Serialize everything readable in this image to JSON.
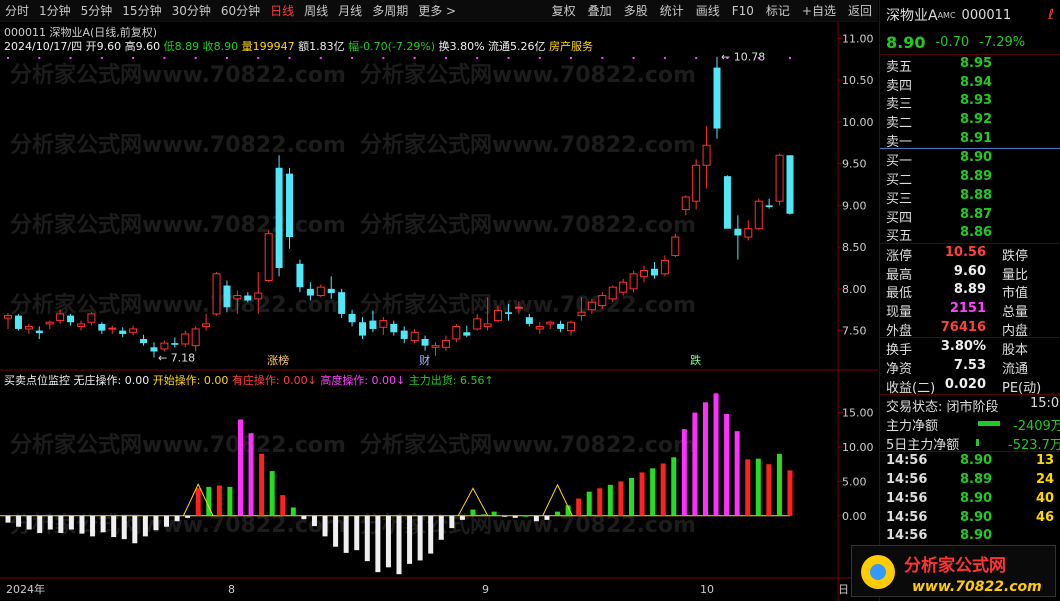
{
  "toolbar": {
    "left": [
      "分时",
      "1分钟",
      "5分钟",
      "15分钟",
      "30分钟",
      "60分钟",
      "日线",
      "周线",
      "月线",
      "多周期",
      "更多 >"
    ],
    "active_index": 6,
    "right": [
      "复权",
      "叠加",
      "多股",
      "统计",
      "画线",
      "F10",
      "标记",
      "+自选",
      "返回"
    ]
  },
  "chart_header": {
    "title": "000011 深物业A(日线,前复权)",
    "date": "2024/10/17/四",
    "open": "开9.60",
    "high": "高9.60",
    "low": "低8.89",
    "close": "收8.90",
    "volume": "量199947",
    "amount": "额1.83亿",
    "change": "幅-0.70(-7.29%)",
    "turnover": "换3.80%",
    "float": "流通5.26亿",
    "sector": "房产服务"
  },
  "price_axis": [
    "11.00",
    "10.50",
    "10.00",
    "9.50",
    "9.00",
    "8.50",
    "8.00",
    "7.50"
  ],
  "price_annotations": {
    "high": "10.78",
    "low": "7.18"
  },
  "event_tags": [
    "涨榜",
    "财",
    "跌"
  ],
  "indicator_header": {
    "name": "买卖点位监控",
    "items": [
      {
        "label": "无庄操作: 0.00",
        "color": "white"
      },
      {
        "label": "开始操作: 0.00",
        "color": "yellow"
      },
      {
        "label": "有庄操作: 0.00",
        "color": "red",
        "arrow": "↓"
      },
      {
        "label": "高度操作: 0.00",
        "color": "mag",
        "arrow": "↓"
      },
      {
        "label": "主力出货: 6.56",
        "color": "green",
        "arrow": "↑"
      }
    ]
  },
  "indicator_axis": [
    "15.00",
    "10.00",
    "5.00",
    "0.00"
  ],
  "x_axis": [
    "2024年",
    "8",
    "9",
    "10",
    "日"
  ],
  "watermark": "分析家公式网www.70822.com",
  "chart_data": {
    "type": "candlestick",
    "ohlc": [
      [
        7.65,
        7.71,
        7.52,
        7.68
      ],
      [
        7.68,
        7.7,
        7.5,
        7.52
      ],
      [
        7.52,
        7.58,
        7.46,
        7.55
      ],
      [
        7.5,
        7.55,
        7.4,
        7.47
      ],
      [
        7.58,
        7.62,
        7.52,
        7.6
      ],
      [
        7.62,
        7.75,
        7.58,
        7.7
      ],
      [
        7.68,
        7.7,
        7.56,
        7.6
      ],
      [
        7.55,
        7.62,
        7.5,
        7.58
      ],
      [
        7.6,
        7.72,
        7.56,
        7.7
      ],
      [
        7.58,
        7.6,
        7.46,
        7.5
      ],
      [
        7.52,
        7.56,
        7.46,
        7.53
      ],
      [
        7.5,
        7.54,
        7.42,
        7.46
      ],
      [
        7.48,
        7.56,
        7.44,
        7.52
      ],
      [
        7.4,
        7.45,
        7.32,
        7.35
      ],
      [
        7.3,
        7.36,
        7.18,
        7.25
      ],
      [
        7.28,
        7.38,
        7.25,
        7.35
      ],
      [
        7.35,
        7.42,
        7.3,
        7.33
      ],
      [
        7.34,
        7.5,
        7.3,
        7.46
      ],
      [
        7.32,
        7.55,
        7.25,
        7.52
      ],
      [
        7.55,
        7.7,
        7.5,
        7.58
      ],
      [
        7.7,
        8.2,
        7.68,
        8.18
      ],
      [
        8.04,
        8.1,
        7.72,
        7.78
      ],
      [
        7.88,
        7.98,
        7.7,
        7.92
      ],
      [
        7.92,
        7.96,
        7.84,
        7.86
      ],
      [
        7.88,
        8.2,
        7.7,
        7.95
      ],
      [
        8.1,
        8.7,
        8.08,
        8.66
      ],
      [
        9.45,
        9.6,
        8.15,
        8.25
      ],
      [
        9.38,
        9.45,
        8.48,
        8.62
      ],
      [
        8.3,
        8.35,
        7.96,
        8.02
      ],
      [
        8.0,
        8.08,
        7.86,
        7.92
      ],
      [
        7.92,
        8.05,
        7.9,
        8.02
      ],
      [
        8.0,
        8.15,
        7.88,
        7.95
      ],
      [
        7.96,
        8.0,
        7.65,
        7.7
      ],
      [
        7.7,
        7.75,
        7.55,
        7.6
      ],
      [
        7.6,
        7.66,
        7.4,
        7.44
      ],
      [
        7.62,
        7.74,
        7.48,
        7.52
      ],
      [
        7.54,
        7.66,
        7.45,
        7.62
      ],
      [
        7.58,
        7.62,
        7.44,
        7.48
      ],
      [
        7.5,
        7.55,
        7.35,
        7.4
      ],
      [
        7.38,
        7.52,
        7.35,
        7.48
      ],
      [
        7.4,
        7.44,
        7.26,
        7.32
      ],
      [
        7.3,
        7.36,
        7.2,
        7.32
      ],
      [
        7.3,
        7.44,
        7.26,
        7.38
      ],
      [
        7.4,
        7.58,
        7.36,
        7.55
      ],
      [
        7.48,
        7.56,
        7.42,
        7.44
      ],
      [
        7.52,
        7.7,
        7.5,
        7.64
      ],
      [
        7.55,
        7.9,
        7.5,
        7.58
      ],
      [
        7.62,
        7.8,
        7.6,
        7.74
      ],
      [
        7.72,
        7.82,
        7.62,
        7.7
      ],
      [
        7.78,
        7.85,
        7.7,
        7.78
      ],
      [
        7.66,
        7.7,
        7.55,
        7.58
      ],
      [
        7.52,
        7.6,
        7.46,
        7.55
      ],
      [
        7.58,
        7.62,
        7.52,
        7.6
      ],
      [
        7.58,
        7.62,
        7.48,
        7.52
      ],
      [
        7.5,
        7.62,
        7.44,
        7.6
      ],
      [
        7.68,
        7.9,
        7.62,
        7.72
      ],
      [
        7.75,
        7.88,
        7.7,
        7.84
      ],
      [
        7.8,
        7.96,
        7.76,
        7.92
      ],
      [
        7.88,
        8.04,
        7.84,
        8.02
      ],
      [
        7.96,
        8.12,
        7.92,
        8.08
      ],
      [
        8.0,
        8.22,
        7.96,
        8.18
      ],
      [
        8.15,
        8.28,
        8.08,
        8.22
      ],
      [
        8.24,
        8.32,
        8.12,
        8.16
      ],
      [
        8.18,
        8.4,
        8.15,
        8.34
      ],
      [
        8.4,
        8.66,
        8.38,
        8.62
      ],
      [
        8.95,
        9.12,
        8.88,
        9.1
      ],
      [
        9.05,
        9.55,
        8.95,
        9.48
      ],
      [
        9.48,
        9.95,
        9.2,
        9.72
      ],
      [
        10.65,
        10.78,
        9.8,
        9.92
      ],
      [
        9.35,
        9.36,
        8.75,
        8.72
      ],
      [
        8.72,
        8.88,
        8.35,
        8.64
      ],
      [
        8.62,
        8.82,
        8.58,
        8.72
      ],
      [
        8.72,
        9.08,
        8.7,
        9.05
      ],
      [
        9.0,
        9.08,
        8.96,
        8.98
      ],
      [
        9.05,
        9.62,
        9.0,
        9.6
      ],
      [
        9.6,
        9.6,
        8.89,
        8.9
      ]
    ],
    "ylim": [
      7.1,
      11.1
    ],
    "indicator": [
      -1.0,
      -1.6,
      -2.0,
      -2.5,
      -2.0,
      -2.5,
      -2.0,
      -2.6,
      -3.0,
      -2.4,
      -3.1,
      -3.4,
      -4.0,
      -3.0,
      -2.1,
      -1.6,
      -0.8,
      -0.3,
      4.0,
      4.2,
      4.4,
      4.2,
      14.0,
      12.0,
      9.0,
      6.5,
      3.0,
      1.2,
      -0.5,
      -1.5,
      -3.0,
      -4.5,
      -5.4,
      -5.0,
      -6.6,
      -8.2,
      -7.5,
      -8.5,
      -7.0,
      -6.5,
      -5.5,
      -3.5,
      -1.8,
      -0.6,
      0.9,
      0.2,
      0.6,
      -0.1,
      -0.3,
      0.0,
      -0.8,
      -0.6,
      0.6,
      1.5,
      2.5,
      3.5,
      4.0,
      4.5,
      5.0,
      5.5,
      6.3,
      6.9,
      7.6,
      8.5,
      12.6,
      15.0,
      16.5,
      17.8,
      14.8,
      12.3,
      8.2,
      8.3,
      7.5,
      9.0,
      6.6
    ],
    "indicator_colors": [
      "white",
      "red",
      "green",
      "magenta"
    ],
    "ylim_indicator": [
      -6.0,
      18.0
    ]
  },
  "quote": {
    "name": "深物业A",
    "badge": "AMC",
    "code": "000011",
    "price": "8.90",
    "change": "-0.70",
    "pct": "-7.29%",
    "asks": [
      {
        "label": "卖五",
        "price": "8.95"
      },
      {
        "label": "卖四",
        "price": "8.94"
      },
      {
        "label": "卖三",
        "price": "8.93"
      },
      {
        "label": "卖二",
        "price": "8.92"
      },
      {
        "label": "卖一",
        "price": "8.91"
      }
    ],
    "bids": [
      {
        "label": "买一",
        "price": "8.90"
      },
      {
        "label": "买二",
        "price": "8.89"
      },
      {
        "label": "买三",
        "price": "8.88"
      },
      {
        "label": "买四",
        "price": "8.87"
      },
      {
        "label": "买五",
        "price": "8.86"
      }
    ],
    "stats": [
      {
        "l": "涨停",
        "v": "10.56",
        "r": "跌停",
        "vc": "red"
      },
      {
        "l": "最高",
        "v": "9.60",
        "r": "量比",
        "vc": "white"
      },
      {
        "l": "最低",
        "v": "8.89",
        "r": "市值",
        "vc": "white"
      },
      {
        "l": "现量",
        "v": "2151",
        "r": "总量",
        "vc": "mag"
      },
      {
        "l": "外盘",
        "v": "76416",
        "r": "内盘",
        "vc": "red"
      }
    ],
    "stats2": [
      {
        "l": "换手",
        "v": "3.80%",
        "r": "股本"
      },
      {
        "l": "净资",
        "v": "7.53",
        "r": "流通"
      },
      {
        "l": "收益(二)",
        "v": "0.020",
        "r": "PE(动)"
      }
    ],
    "status_label": "交易状态: 闭市阶段",
    "status_time": "15:0",
    "net_inflow_label": "主力净额",
    "net_inflow": "-2409万",
    "net5_label": "5日主力净额",
    "net5": "-523.7万",
    "ticks": [
      {
        "t": "14:56",
        "p": "8.90",
        "v": "13",
        "pc": "green",
        "vc": "yellow"
      },
      {
        "t": "14:56",
        "p": "8.89",
        "v": "24",
        "pc": "green",
        "vc": "yellow"
      },
      {
        "t": "14:56",
        "p": "8.90",
        "v": "40",
        "pc": "green",
        "vc": "yellow"
      },
      {
        "t": "14:56",
        "p": "8.90",
        "v": "46",
        "pc": "green",
        "vc": "yellow"
      },
      {
        "t": "14:56",
        "p": "8.90",
        "v": "",
        "pc": "green",
        "vc": "yellow"
      }
    ]
  },
  "logo": {
    "title": "分析家公式网",
    "url": "www.70822.com"
  }
}
